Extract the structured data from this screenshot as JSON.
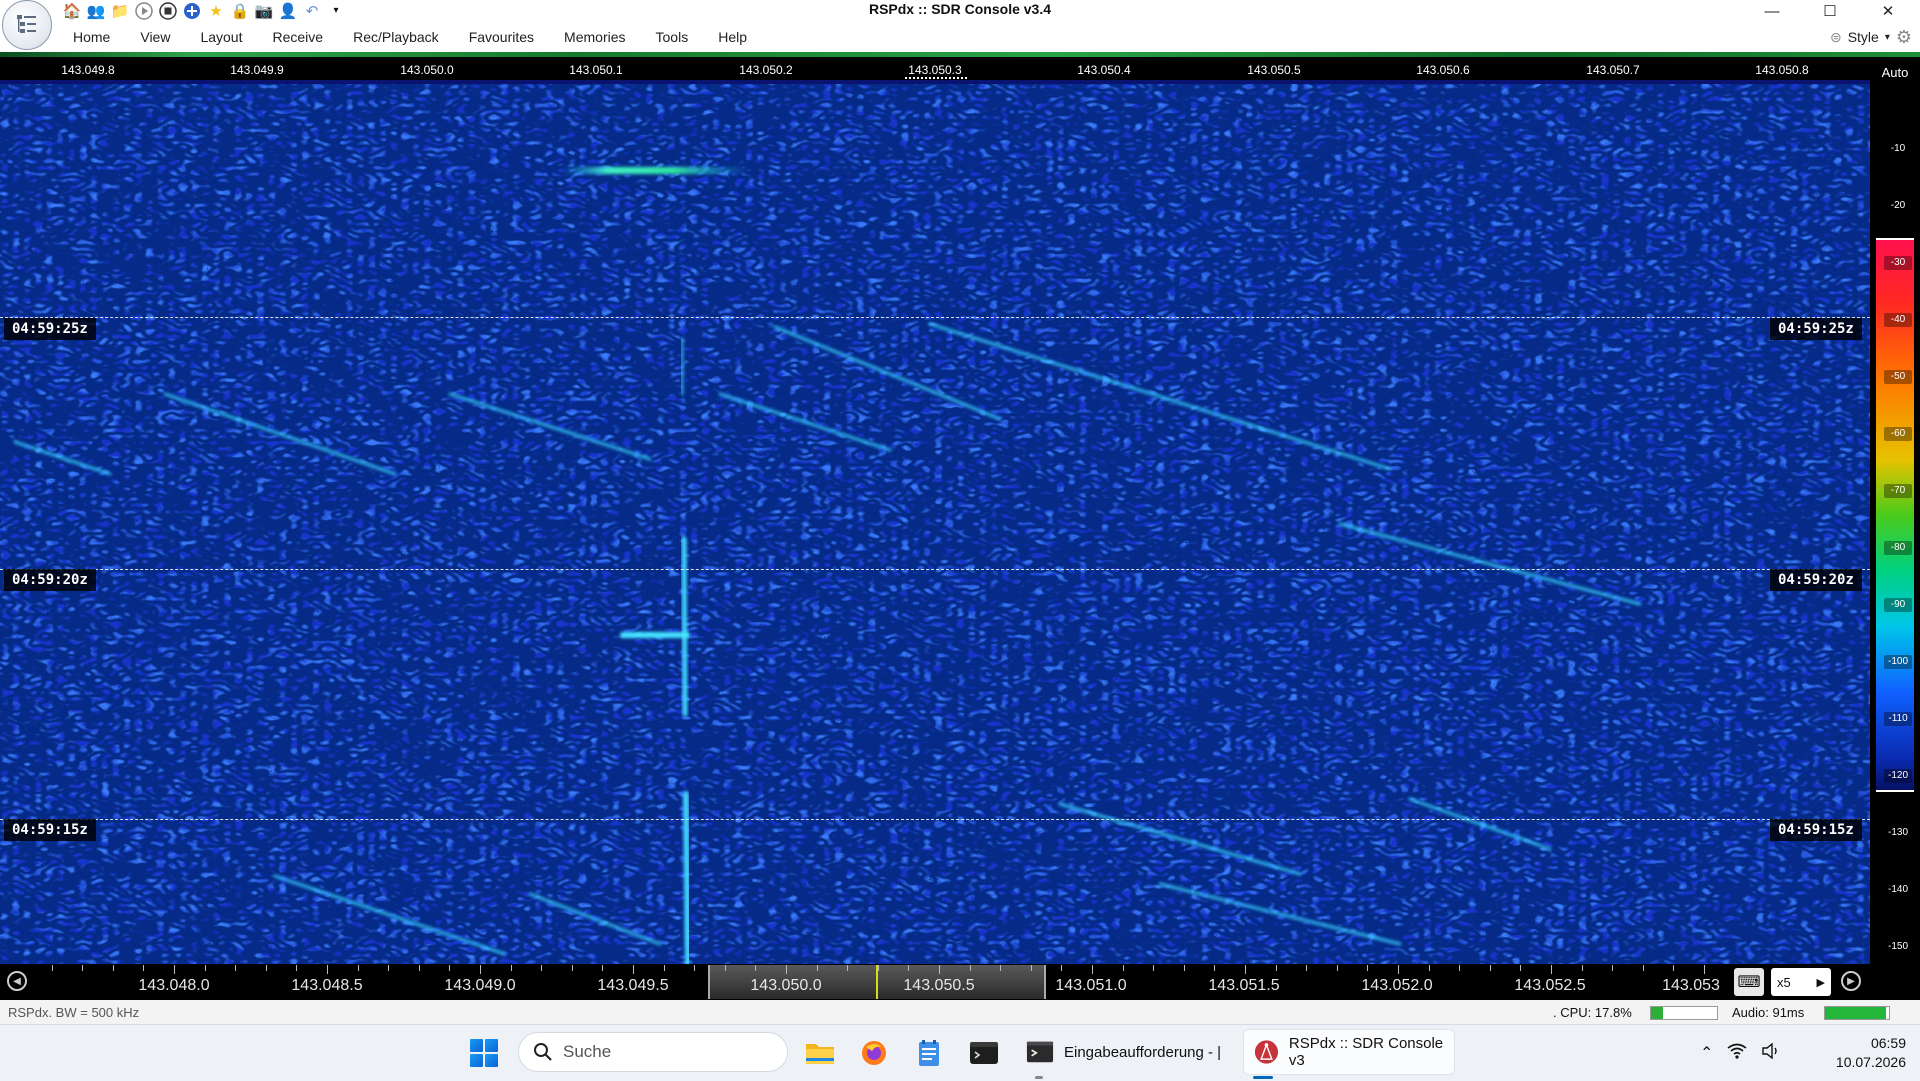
{
  "window": {
    "title": "RSPdx :: SDR Console v3.4",
    "quick_access_icons": [
      "home-icon",
      "users-icon",
      "folder-icon",
      "play-icon",
      "stop-icon",
      "add-icon",
      "star-icon",
      "lock-icon",
      "camera-icon",
      "user-icon",
      "undo-icon",
      "dropdown-icon"
    ],
    "minimize": "—",
    "maximize": "☐",
    "close": "✕"
  },
  "menu": {
    "items": [
      "Home",
      "View",
      "Layout",
      "Receive",
      "Rec/Playback",
      "Favourites",
      "Memories",
      "Tools",
      "Help"
    ],
    "style_label": "Style"
  },
  "top_axis": {
    "labels": [
      "143.049.8",
      "143.049.9",
      "143.050.0",
      "143.050.1",
      "143.050.2",
      "143.050.3",
      "143.050.4",
      "143.050.5",
      "143.050.6",
      "143.050.7",
      "143.050.8"
    ]
  },
  "scale": {
    "auto_label": "Auto",
    "ticks": [
      "-10",
      "-20",
      "-30",
      "-40",
      "-50",
      "-60",
      "-70",
      "-80",
      "-90",
      "-100",
      "-110",
      "-120",
      "-130",
      "-140",
      "-150"
    ]
  },
  "waterfall": {
    "time_markers": [
      "04:59:25z",
      "04:59:20z",
      "04:59:15z"
    ]
  },
  "bottom_axis": {
    "labels": [
      "143.048.0",
      "143.048.5",
      "143.049.0",
      "143.049.5",
      "143.050.0",
      "143.050.5",
      "143.051.0",
      "143.051.5",
      "143.052.0",
      "143.052.5",
      "143.053"
    ],
    "zoom": "x5"
  },
  "status": {
    "left": "RSPdx. BW = 500 kHz",
    "cpu": ". CPU: 17.8%",
    "cpu_fraction": 0.178,
    "audio": "Audio: 91ms",
    "audio_fraction": 0.95
  },
  "taskbar": {
    "search_placeholder": "Suche",
    "apps": [
      {
        "label": "Eingabeaufforderung - |"
      },
      {
        "label": "RSPdx :: SDR Console v3"
      }
    ],
    "time": "06:59",
    "date": "10.07.2026"
  },
  "colors": {
    "waterfall_bg": "#0a1470",
    "signal": "#35e6ff",
    "accent": "#0067c0"
  }
}
